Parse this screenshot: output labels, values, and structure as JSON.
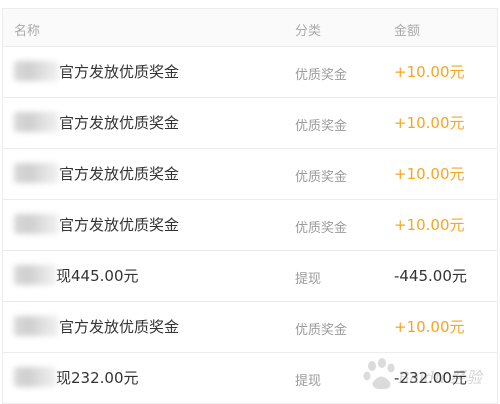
{
  "table": {
    "headers": {
      "name": "名称",
      "category": "分类",
      "amount": "金额"
    },
    "rows": [
      {
        "name": "官方发放优质奖金",
        "category": "优质奖金",
        "amount": "+10.00元",
        "type": "credit"
      },
      {
        "name": "官方发放优质奖金",
        "category": "优质奖金",
        "amount": "+10.00元",
        "type": "credit"
      },
      {
        "name": "官方发放优质奖金",
        "category": "优质奖金",
        "amount": "+10.00元",
        "type": "credit"
      },
      {
        "name": "官方发放优质奖金",
        "category": "优质奖金",
        "amount": "+10.00元",
        "type": "credit"
      },
      {
        "name": "现445.00元",
        "category": "提现",
        "amount": "-445.00元",
        "type": "debit"
      },
      {
        "name": "官方发放优质奖金",
        "category": "优质奖金",
        "amount": "+10.00元",
        "type": "credit"
      },
      {
        "name": "现232.00元",
        "category": "提现",
        "amount": "-232.00元",
        "type": "debit"
      }
    ]
  },
  "colors": {
    "credit": "#f5a623",
    "debit": "#333333",
    "header_bg": "#fafafa",
    "border": "#ececec"
  },
  "watermark": {
    "text": "Baidu 经验"
  }
}
